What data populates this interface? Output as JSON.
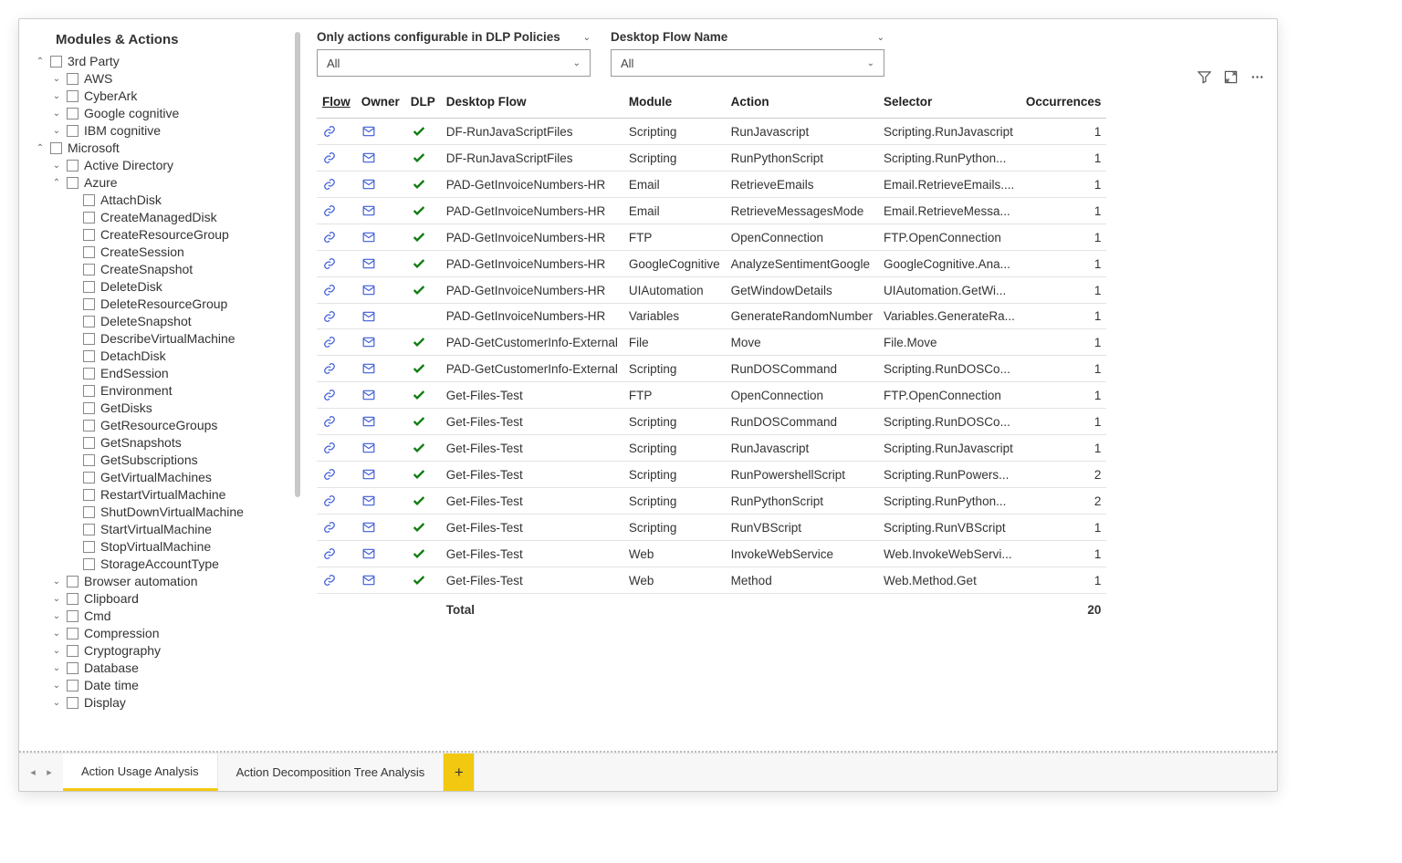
{
  "sidebar": {
    "title": "Modules & Actions",
    "nodes": [
      {
        "depth": 0,
        "caret": "up",
        "label": "3rd Party"
      },
      {
        "depth": 1,
        "caret": "down",
        "label": "AWS"
      },
      {
        "depth": 1,
        "caret": "down",
        "label": "CyberArk"
      },
      {
        "depth": 1,
        "caret": "down",
        "label": "Google cognitive"
      },
      {
        "depth": 1,
        "caret": "down",
        "label": "IBM cognitive"
      },
      {
        "depth": 0,
        "caret": "up",
        "label": "Microsoft"
      },
      {
        "depth": 1,
        "caret": "down",
        "label": "Active Directory"
      },
      {
        "depth": 1,
        "caret": "up",
        "label": "Azure"
      },
      {
        "depth": 2,
        "caret": "",
        "label": "AttachDisk"
      },
      {
        "depth": 2,
        "caret": "",
        "label": "CreateManagedDisk"
      },
      {
        "depth": 2,
        "caret": "",
        "label": "CreateResourceGroup"
      },
      {
        "depth": 2,
        "caret": "",
        "label": "CreateSession"
      },
      {
        "depth": 2,
        "caret": "",
        "label": "CreateSnapshot"
      },
      {
        "depth": 2,
        "caret": "",
        "label": "DeleteDisk"
      },
      {
        "depth": 2,
        "caret": "",
        "label": "DeleteResourceGroup"
      },
      {
        "depth": 2,
        "caret": "",
        "label": "DeleteSnapshot"
      },
      {
        "depth": 2,
        "caret": "",
        "label": "DescribeVirtualMachine"
      },
      {
        "depth": 2,
        "caret": "",
        "label": "DetachDisk"
      },
      {
        "depth": 2,
        "caret": "",
        "label": "EndSession"
      },
      {
        "depth": 2,
        "caret": "",
        "label": "Environment"
      },
      {
        "depth": 2,
        "caret": "",
        "label": "GetDisks"
      },
      {
        "depth": 2,
        "caret": "",
        "label": "GetResourceGroups"
      },
      {
        "depth": 2,
        "caret": "",
        "label": "GetSnapshots"
      },
      {
        "depth": 2,
        "caret": "",
        "label": "GetSubscriptions"
      },
      {
        "depth": 2,
        "caret": "",
        "label": "GetVirtualMachines"
      },
      {
        "depth": 2,
        "caret": "",
        "label": "RestartVirtualMachine"
      },
      {
        "depth": 2,
        "caret": "",
        "label": "ShutDownVirtualMachine"
      },
      {
        "depth": 2,
        "caret": "",
        "label": "StartVirtualMachine"
      },
      {
        "depth": 2,
        "caret": "",
        "label": "StopVirtualMachine"
      },
      {
        "depth": 2,
        "caret": "",
        "label": "StorageAccountType"
      },
      {
        "depth": 1,
        "caret": "down",
        "label": "Browser automation"
      },
      {
        "depth": 1,
        "caret": "down",
        "label": "Clipboard"
      },
      {
        "depth": 1,
        "caret": "down",
        "label": "Cmd"
      },
      {
        "depth": 1,
        "caret": "down",
        "label": "Compression"
      },
      {
        "depth": 1,
        "caret": "down",
        "label": "Cryptography"
      },
      {
        "depth": 1,
        "caret": "down",
        "label": "Database"
      },
      {
        "depth": 1,
        "caret": "down",
        "label": "Date time"
      },
      {
        "depth": 1,
        "caret": "down",
        "label": "Display"
      }
    ]
  },
  "filters": {
    "left": {
      "label": "Only actions configurable in DLP Policies",
      "value": "All"
    },
    "right": {
      "label": "Desktop Flow Name",
      "value": "All"
    }
  },
  "table": {
    "headers": {
      "flow": "Flow",
      "owner": "Owner",
      "dlp": "DLP",
      "desktop": "Desktop Flow",
      "module": "Module",
      "action": "Action",
      "selector": "Selector",
      "occ": "Occurrences"
    },
    "rows": [
      {
        "dlp": true,
        "desktop": "DF-RunJavaScriptFiles",
        "module": "Scripting",
        "action": "RunJavascript",
        "selector": "Scripting.RunJavascript",
        "occ": 1
      },
      {
        "dlp": true,
        "desktop": "DF-RunJavaScriptFiles",
        "module": "Scripting",
        "action": "RunPythonScript",
        "selector": "Scripting.RunPython...",
        "occ": 1
      },
      {
        "dlp": true,
        "desktop": "PAD-GetInvoiceNumbers-HR",
        "module": "Email",
        "action": "RetrieveEmails",
        "selector": "Email.RetrieveEmails....",
        "occ": 1
      },
      {
        "dlp": true,
        "desktop": "PAD-GetInvoiceNumbers-HR",
        "module": "Email",
        "action": "RetrieveMessagesMode",
        "selector": "Email.RetrieveMessa...",
        "occ": 1
      },
      {
        "dlp": true,
        "desktop": "PAD-GetInvoiceNumbers-HR",
        "module": "FTP",
        "action": "OpenConnection",
        "selector": "FTP.OpenConnection",
        "occ": 1
      },
      {
        "dlp": true,
        "desktop": "PAD-GetInvoiceNumbers-HR",
        "module": "GoogleCognitive",
        "action": "AnalyzeSentimentGoogle",
        "selector": "GoogleCognitive.Ana...",
        "occ": 1
      },
      {
        "dlp": true,
        "desktop": "PAD-GetInvoiceNumbers-HR",
        "module": "UIAutomation",
        "action": "GetWindowDetails",
        "selector": "UIAutomation.GetWi...",
        "occ": 1
      },
      {
        "dlp": false,
        "desktop": "PAD-GetInvoiceNumbers-HR",
        "module": "Variables",
        "action": "GenerateRandomNumber",
        "selector": "Variables.GenerateRa...",
        "occ": 1
      },
      {
        "dlp": true,
        "desktop": "PAD-GetCustomerInfo-External",
        "module": "File",
        "action": "Move",
        "selector": "File.Move",
        "occ": 1
      },
      {
        "dlp": true,
        "desktop": "PAD-GetCustomerInfo-External",
        "module": "Scripting",
        "action": "RunDOSCommand",
        "selector": "Scripting.RunDOSCo...",
        "occ": 1
      },
      {
        "dlp": true,
        "desktop": "Get-Files-Test",
        "module": "FTP",
        "action": "OpenConnection",
        "selector": "FTP.OpenConnection",
        "occ": 1
      },
      {
        "dlp": true,
        "desktop": "Get-Files-Test",
        "module": "Scripting",
        "action": "RunDOSCommand",
        "selector": "Scripting.RunDOSCo...",
        "occ": 1
      },
      {
        "dlp": true,
        "desktop": "Get-Files-Test",
        "module": "Scripting",
        "action": "RunJavascript",
        "selector": "Scripting.RunJavascript",
        "occ": 1
      },
      {
        "dlp": true,
        "desktop": "Get-Files-Test",
        "module": "Scripting",
        "action": "RunPowershellScript",
        "selector": "Scripting.RunPowers...",
        "occ": 2
      },
      {
        "dlp": true,
        "desktop": "Get-Files-Test",
        "module": "Scripting",
        "action": "RunPythonScript",
        "selector": "Scripting.RunPython...",
        "occ": 2
      },
      {
        "dlp": true,
        "desktop": "Get-Files-Test",
        "module": "Scripting",
        "action": "RunVBScript",
        "selector": "Scripting.RunVBScript",
        "occ": 1
      },
      {
        "dlp": true,
        "desktop": "Get-Files-Test",
        "module": "Web",
        "action": "InvokeWebService",
        "selector": "Web.InvokeWebServi...",
        "occ": 1
      },
      {
        "dlp": true,
        "desktop": "Get-Files-Test",
        "module": "Web",
        "action": "Method",
        "selector": "Web.Method.Get",
        "occ": 1
      }
    ],
    "total_label": "Total",
    "total_value": 20
  },
  "tabs": {
    "active": "Action Usage Analysis",
    "other": "Action Decomposition Tree Analysis",
    "add": "+"
  }
}
